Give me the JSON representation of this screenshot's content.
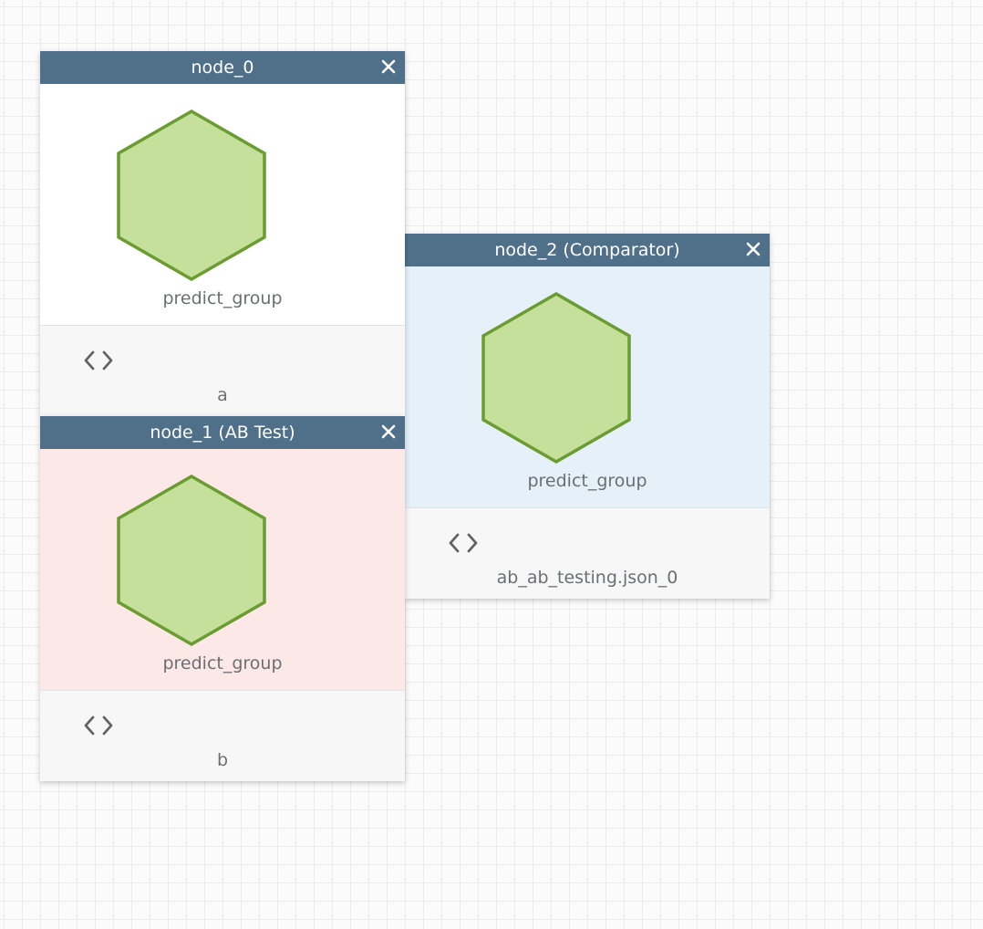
{
  "colors": {
    "header_bg": "#50708a",
    "node_default_body": "#ffffff",
    "ab_test_body": "#fde8e8",
    "comparator_body": "#e5f0f8",
    "hexagon_fill": "#c5e09b",
    "hexagon_stroke": "#6a9c32"
  },
  "nodes": [
    {
      "title": "node_0",
      "type_label": "predict_group",
      "footer_label": "a",
      "close_icon": "close-icon",
      "main_icon": "hexagon-icon",
      "footer_icon": "code-icon"
    },
    {
      "title": "node_1 (AB Test)",
      "type_label": "predict_group",
      "footer_label": "b",
      "close_icon": "close-icon",
      "main_icon": "hexagon-icon",
      "footer_icon": "code-icon"
    },
    {
      "title": "node_2 (Comparator)",
      "type_label": "predict_group",
      "footer_label": "ab_ab_testing.json_0",
      "close_icon": "close-icon",
      "main_icon": "hexagon-icon",
      "footer_icon": "code-icon"
    }
  ]
}
